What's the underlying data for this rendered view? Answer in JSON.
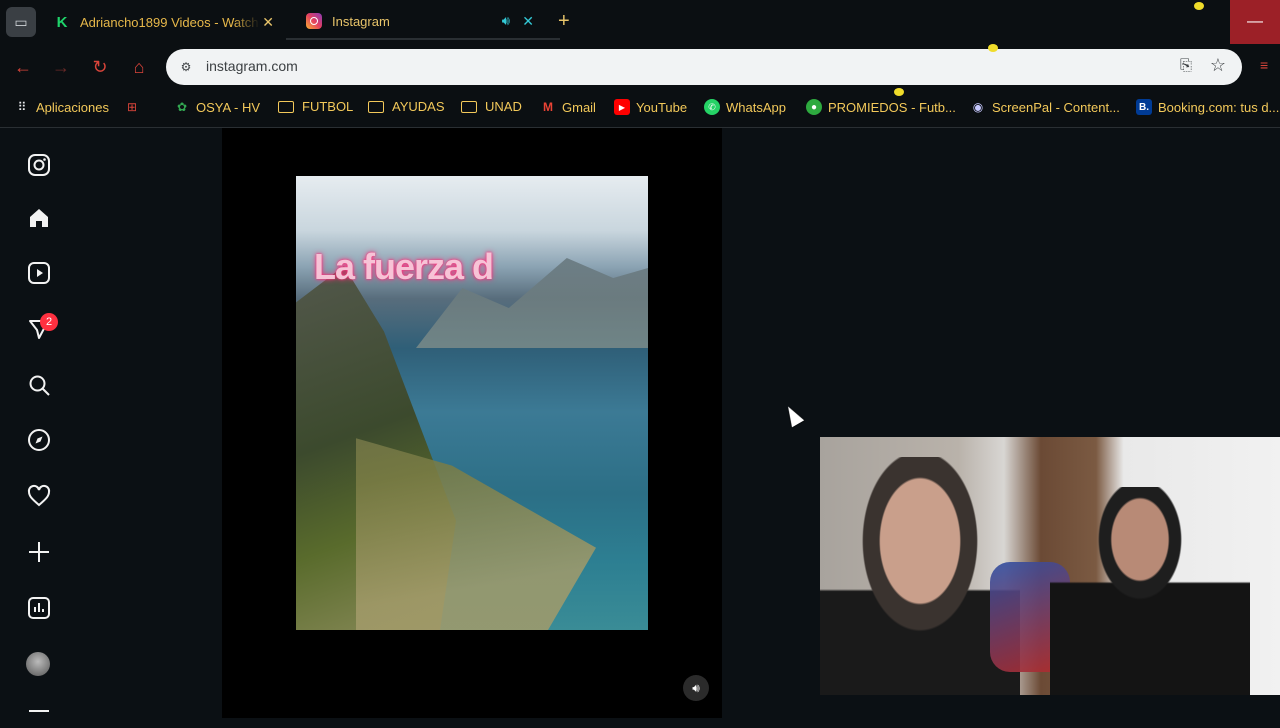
{
  "browser": {
    "tabs": [
      {
        "title": "Adriancho1899 Videos - Watch"
      },
      {
        "title": "Instagram"
      }
    ],
    "new_tab": "+",
    "minimize": "—",
    "url": "instagram.com"
  },
  "bookmarks": [
    {
      "label": "Aplicaciones"
    },
    {
      "label": "OSYA - HV"
    },
    {
      "label": "FUTBOL"
    },
    {
      "label": "AYUDAS"
    },
    {
      "label": "UNAD"
    },
    {
      "label": "Gmail"
    },
    {
      "label": "YouTube"
    },
    {
      "label": "WhatsApp"
    },
    {
      "label": "PROMIEDOS - Futb..."
    },
    {
      "label": "ScreenPal - Content..."
    },
    {
      "label": "Booking.com: tus d..."
    }
  ],
  "sidebar": {
    "notifications_badge": "2"
  },
  "reel": {
    "caption": "La fuerza d"
  },
  "colors": {
    "accent": "#d9443a",
    "badge": "#ff3040",
    "caption_glow": "#ff2d7a"
  }
}
